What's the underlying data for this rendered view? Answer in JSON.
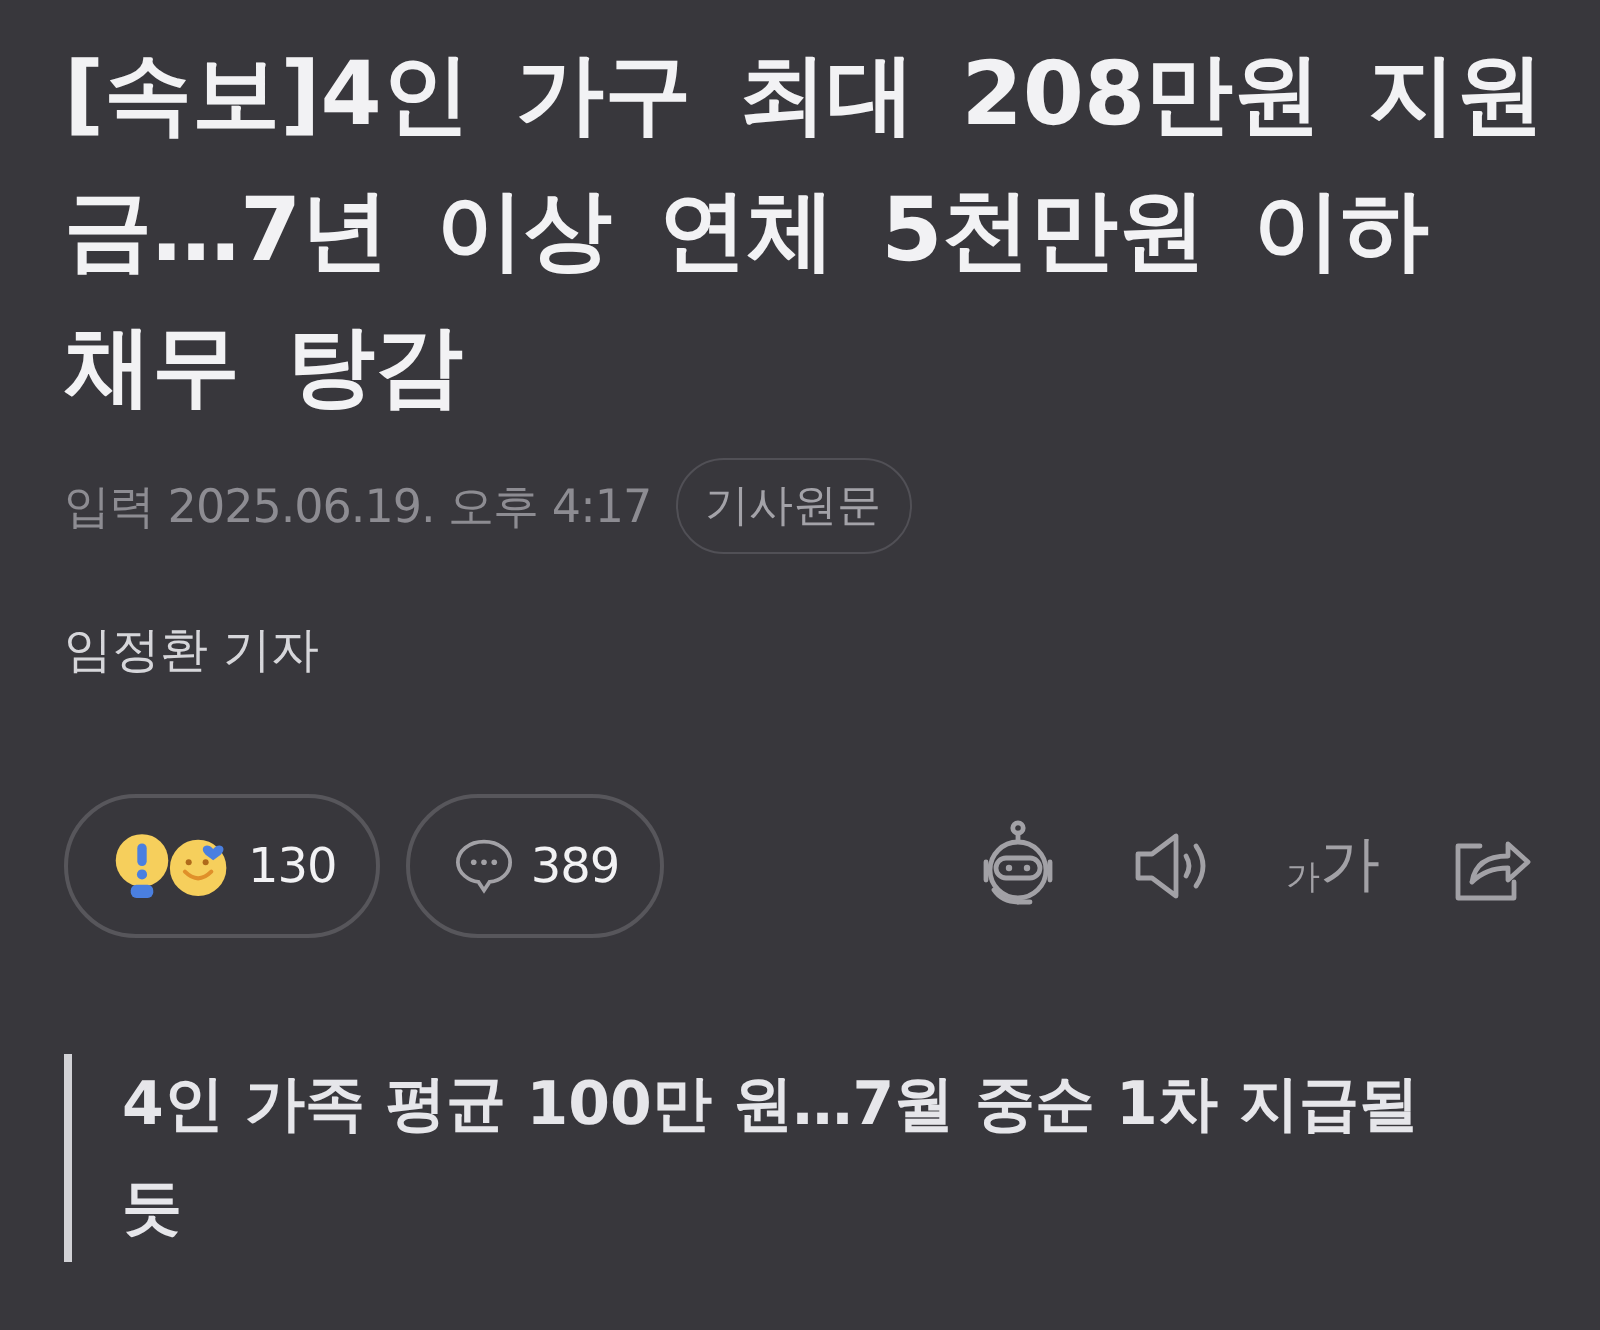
{
  "headline": "[속보]4인 가구 최대 208만원 지원금…7년 이상 연체 5천만원 이하 채무 탕감",
  "meta": {
    "published": "입력 2025.06.19. 오후 4:17",
    "original_link": "기사원문"
  },
  "byline": "임정환 기자",
  "reactions": {
    "count": "130"
  },
  "comments": {
    "count": "389"
  },
  "font_size_button": {
    "small_label": "가",
    "large_label": "가"
  },
  "summary": "4인 가족 평균 100만 원…7월 중순 1차 지급될 듯"
}
